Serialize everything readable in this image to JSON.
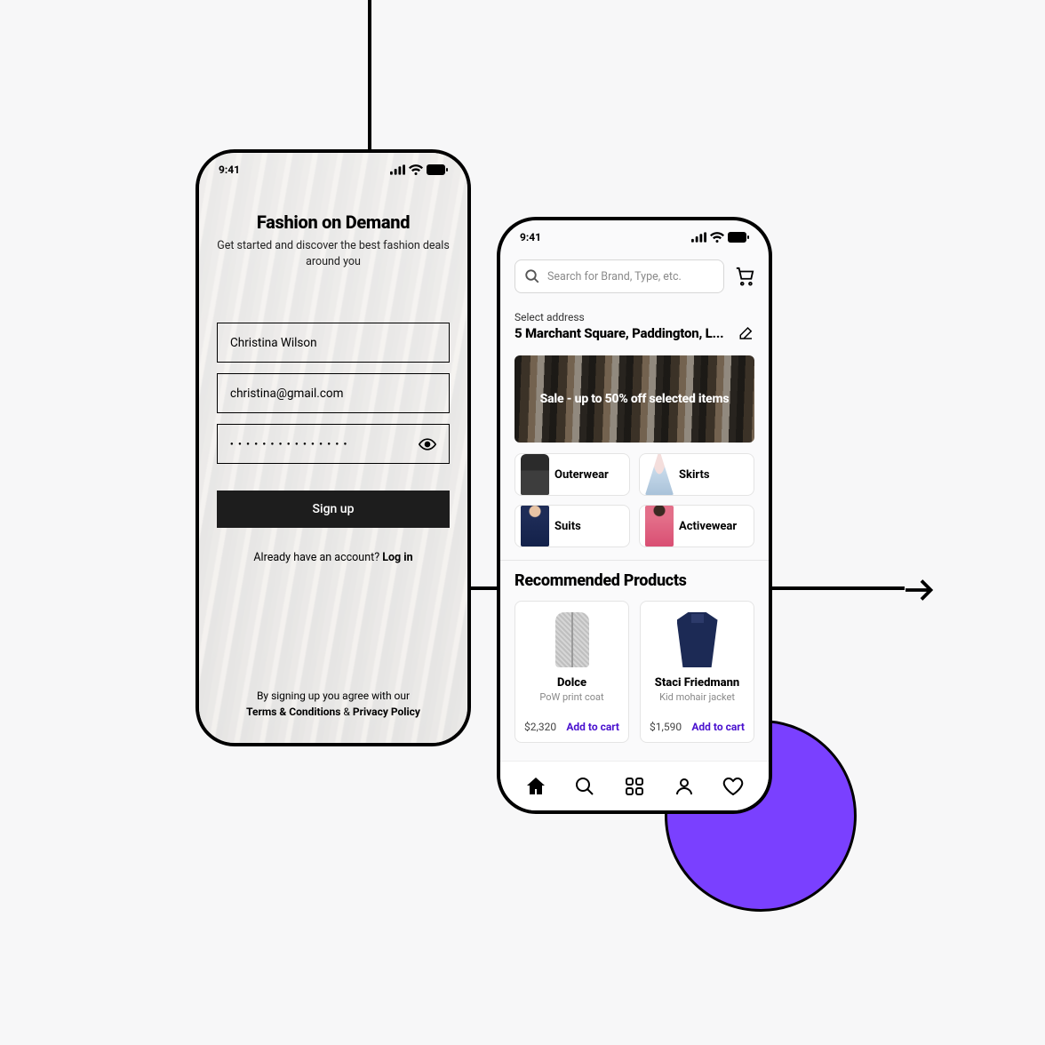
{
  "status_time": "9:41",
  "signup": {
    "title": "Fashion on Demand",
    "subtitle": "Get started and discover the best fashion deals around you",
    "name": "Christina Wilson",
    "email": "christina@gmail.com",
    "password_mask": "●  ●  ●  ●  ●  ●  ●  ●  ●  ●  ●  ●  ●  ●  ●",
    "signup_btn": "Sign up",
    "login_prefix": "Already have an account? ",
    "login_label": "Log in",
    "legal_prefix": "By signing up you agree with our",
    "legal_terms": "Terms & Conditions",
    "legal_sep": " & ",
    "legal_privacy": "Privacy Policy"
  },
  "home": {
    "search_placeholder": "Search for Brand, Type, etc.",
    "address_label": "Select address",
    "address_value": "5 Marchant Square, Paddington, L...",
    "banner": "Sale - up to 50% off selected items",
    "categories": [
      {
        "label": "Outerwear"
      },
      {
        "label": "Skirts"
      },
      {
        "label": "Suits"
      },
      {
        "label": "Activewear"
      }
    ],
    "recommended_title": "Recommended Products",
    "products": [
      {
        "brand": "Dolce",
        "name": "PoW print coat",
        "price": "$2,320",
        "cta": "Add to cart"
      },
      {
        "brand": "Staci Friedmann",
        "name": "Kid mohair jacket",
        "price": "$1,590",
        "cta": "Add to cart"
      }
    ]
  }
}
